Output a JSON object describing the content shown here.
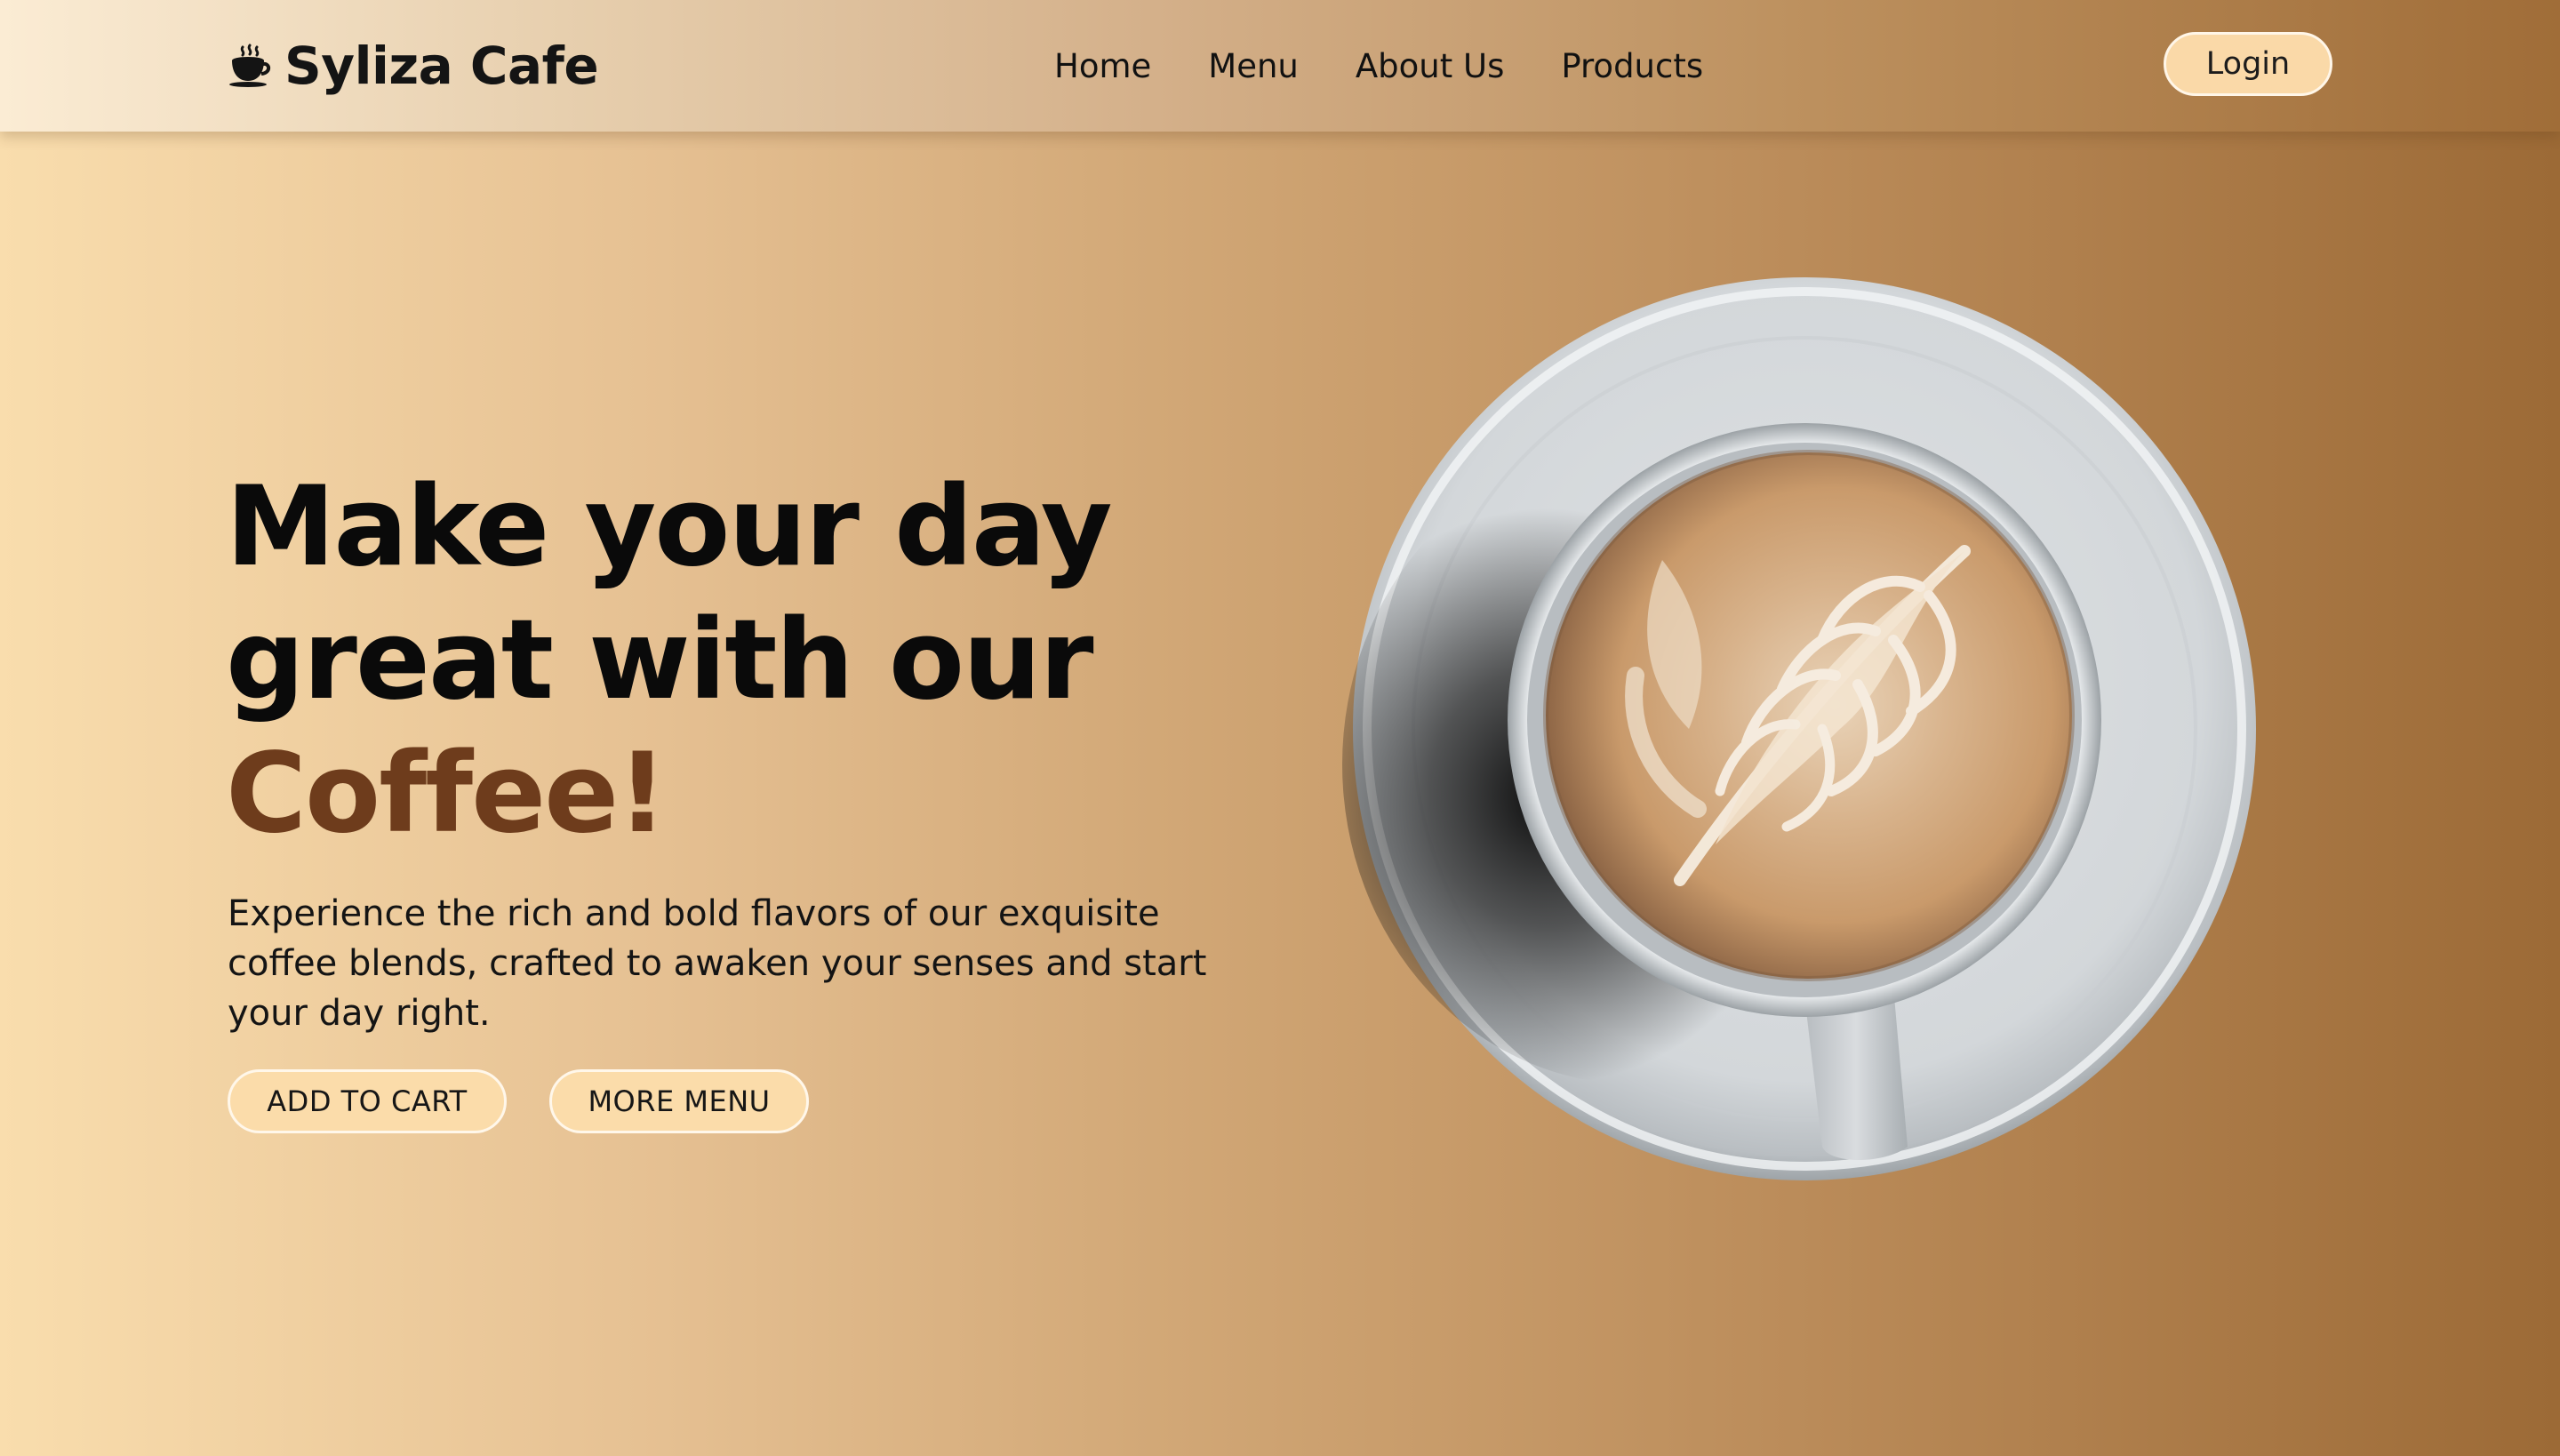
{
  "header": {
    "brand_name": "Syliza Cafe",
    "brand_icon": "coffee-cup-icon",
    "nav": [
      {
        "label": "Home"
      },
      {
        "label": "Menu"
      },
      {
        "label": "About Us"
      },
      {
        "label": "Products"
      }
    ],
    "login_label": "Login"
  },
  "hero": {
    "title_line1": "Make your day",
    "title_line2": "great with our",
    "title_accent": "Coffee!",
    "description": "Experience the rich and bold flavors of our exquisite coffee blends, crafted to awaken your senses and start your day right.",
    "buttons": {
      "add_to_cart": "ADD TO CART",
      "more_menu": "MORE MENU"
    },
    "image": "latte-art-cup-top-view"
  },
  "colors": {
    "accent": "#6e3c1c",
    "button_bg": "#fbdcaa",
    "gradient_start": "#f9ddad",
    "gradient_end": "#9c6a36"
  }
}
